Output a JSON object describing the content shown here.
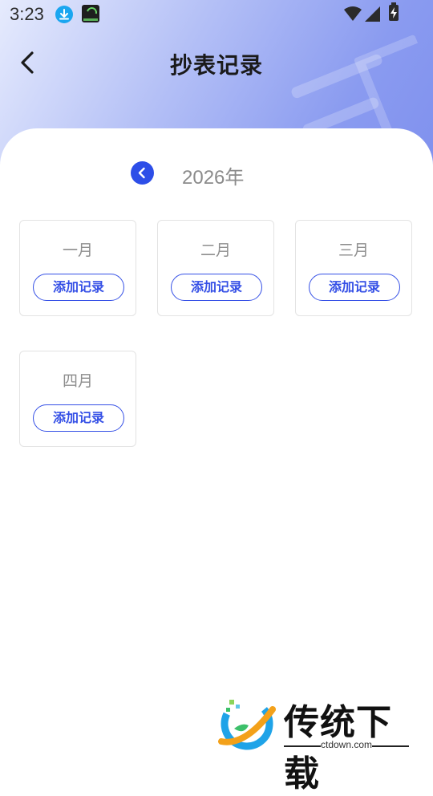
{
  "status_bar": {
    "time": "3:23",
    "icons": [
      "download-icon",
      "app-notification-icon",
      "wifi-icon",
      "signal-icon",
      "battery-charging-icon"
    ]
  },
  "header": {
    "title": "抄表记录",
    "back_icon": "chevron-left-icon"
  },
  "year_nav": {
    "prev_icon": "chevron-left-icon",
    "year": "2026年"
  },
  "months": [
    {
      "name": "一月",
      "button": "添加记录"
    },
    {
      "name": "二月",
      "button": "添加记录"
    },
    {
      "name": "三月",
      "button": "添加记录"
    },
    {
      "name": "四月",
      "button": "添加记录"
    }
  ],
  "watermark": {
    "brand": "传统下载",
    "url": "ctdown.com"
  },
  "colors": {
    "accent": "#3550e6",
    "header_gradient_start": "#e6ebfd",
    "header_gradient_end": "#7f90ee",
    "muted_text": "#8e8e8e",
    "card_border": "#e3e3e3"
  }
}
